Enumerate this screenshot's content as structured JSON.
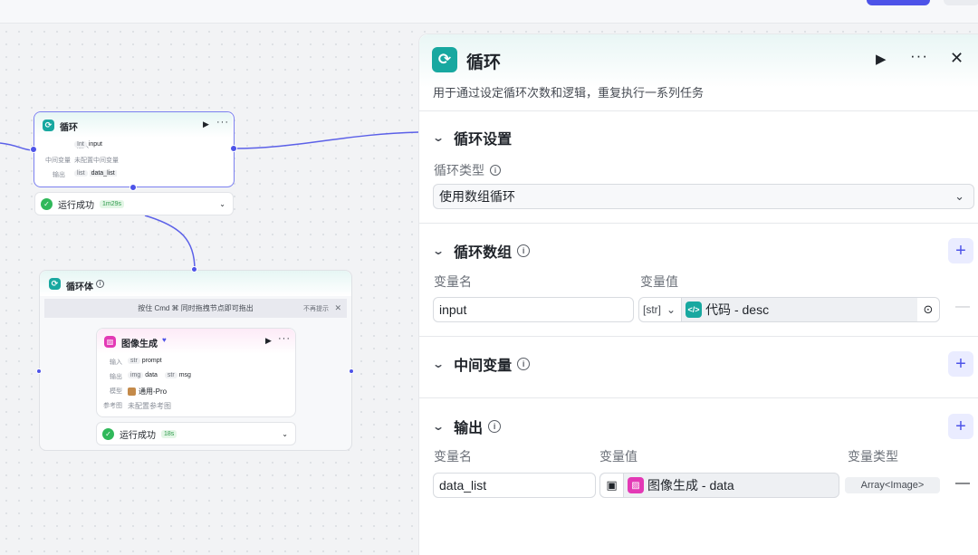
{
  "colors": {
    "accent": "#4d53e8",
    "loop_icon": "#18a8a0",
    "image_icon": "#e339b5",
    "success": "#30b85a"
  },
  "loop_node": {
    "title": "循环",
    "input_label": "输入",
    "input_type": "Int",
    "input_value": "input",
    "mid_label": "中间变量",
    "mid_value": "未配置中间变量",
    "output_label": "输出",
    "output_type": "list",
    "output_value": "data_list",
    "status": "运行成功",
    "time": "1m29s"
  },
  "body_node": {
    "title": "循环体",
    "hint": "按住 Cmd ⌘ 同时拖拽节点即可拖出",
    "hint_dismiss": "不再提示"
  },
  "image_node": {
    "title": "图像生成",
    "input_label": "输入",
    "input_type": "str",
    "input_value": "prompt",
    "output_label": "输出",
    "output_type1": "img",
    "output_value1": "data",
    "output_type2": "str",
    "output_value2": "msg",
    "model_label": "模型",
    "model_value": "通用-Pro",
    "ref_label": "参考图",
    "ref_value": "未配置参考图",
    "status": "运行成功",
    "time": "18s"
  },
  "panel": {
    "title": "循环",
    "description": "用于通过设定循环次数和逻辑，重复执行一系列任务",
    "loop_settings": {
      "title": "循环设置",
      "type_label": "循环类型",
      "type_value": "使用数组循环"
    },
    "loop_array": {
      "title": "循环数组",
      "col_name": "变量名",
      "col_value": "变量值",
      "var_name": "input",
      "type_tag": "[str]",
      "ref_node": "代码 - desc"
    },
    "mid_vars": {
      "title": "中间变量"
    },
    "output": {
      "title": "输出",
      "col_name": "变量名",
      "col_value": "变量值",
      "col_type": "变量类型",
      "var_name": "data_list",
      "ref_node": "图像生成 - data",
      "var_type": "Array<Image>"
    }
  }
}
